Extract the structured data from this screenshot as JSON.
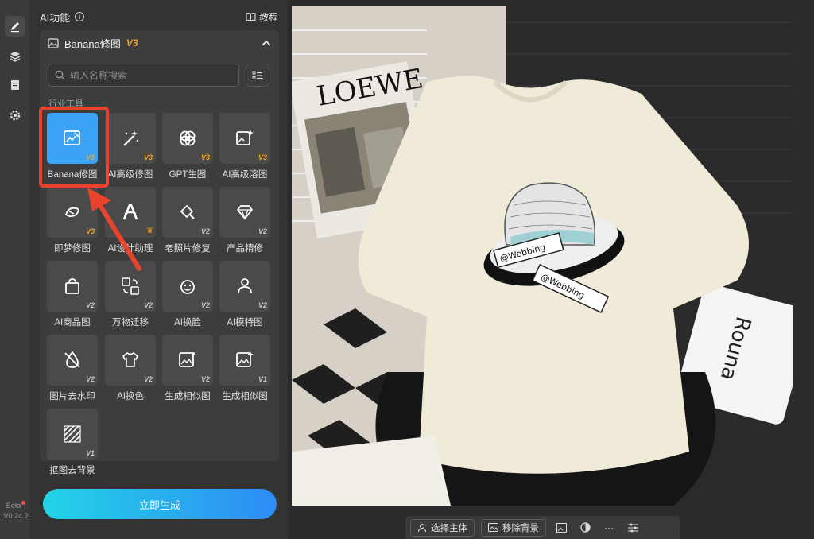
{
  "rail": {
    "version_label": "Beta",
    "version_number": "V0.24.2"
  },
  "panel": {
    "title": "AI功能",
    "tutorial_label": "教程"
  },
  "feature": {
    "title": "Banana修图",
    "version": "V3"
  },
  "search": {
    "placeholder": "输入名称搜索"
  },
  "section_label": "行业工具",
  "tools": [
    {
      "name": "Banana修图",
      "badge": "V3",
      "icon": "image-edit-icon",
      "selected": true
    },
    {
      "name": "AI高级修图",
      "badge": "V3",
      "icon": "magic-wand-icon"
    },
    {
      "name": "GPT生图",
      "badge": "V3",
      "icon": "gpt-knot-icon"
    },
    {
      "name": "AI高级溶图",
      "badge": "V3",
      "icon": "image-sparkle-icon"
    },
    {
      "name": "即梦修图",
      "badge": "V3",
      "icon": "dream-icon"
    },
    {
      "name": "AI设计助理",
      "badge": "crown",
      "icon": "design-a-icon"
    },
    {
      "name": "老照片修复",
      "badge": "V2",
      "icon": "photo-repair-icon"
    },
    {
      "name": "产品精修",
      "badge": "V2",
      "icon": "gem-icon"
    },
    {
      "name": "AI商品图",
      "badge": "V2",
      "icon": "shopping-bag-icon"
    },
    {
      "name": "万物迁移",
      "badge": "V2",
      "icon": "transfer-icon"
    },
    {
      "name": "AI换脸",
      "badge": "V2",
      "icon": "face-swap-icon"
    },
    {
      "name": "AI模特图",
      "badge": "V2",
      "icon": "model-person-icon"
    },
    {
      "name": "图片去水印",
      "badge": "V2",
      "icon": "watermark-remove-icon"
    },
    {
      "name": "AI换色",
      "badge": "V2",
      "icon": "recolor-shirt-icon"
    },
    {
      "name": "生成相似图",
      "badge": "V2",
      "icon": "similar-image-icon"
    },
    {
      "name": "生成相似图",
      "badge": "V1",
      "icon": "similar-image-v1-icon"
    },
    {
      "name": "抠图去背景",
      "badge": "V1",
      "icon": "cutout-bg-icon"
    }
  ],
  "generate_label": "立即生成",
  "canvas": {
    "brand_text": "LOEWE",
    "print_text": "@Webbing",
    "sticker_text": "Rouna"
  },
  "toolbar": {
    "select_subject": "选择主体",
    "remove_bg": "移除背景",
    "more": "···"
  },
  "colors": {
    "accent": "#3ba3f5",
    "highlight": "#e8432c",
    "v3_badge": "#f5a623"
  }
}
